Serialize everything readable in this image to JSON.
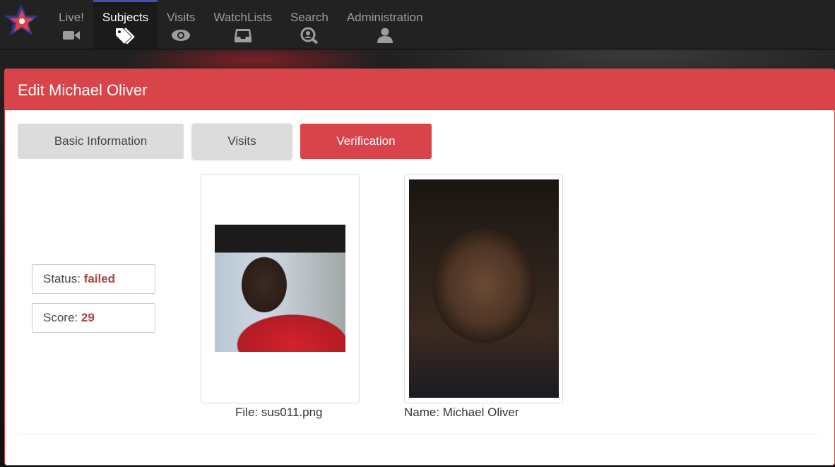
{
  "nav": {
    "items": [
      {
        "label": "Live!",
        "icon": "video-camera-icon"
      },
      {
        "label": "Subjects",
        "icon": "tags-icon",
        "active": true
      },
      {
        "label": "Visits",
        "icon": "eye-icon"
      },
      {
        "label": "WatchLists",
        "icon": "inbox-icon"
      },
      {
        "label": "Search",
        "icon": "search-face-icon"
      },
      {
        "label": "Administration",
        "icon": "user-icon"
      }
    ]
  },
  "panel": {
    "title": "Edit Michael Oliver",
    "tabs": [
      {
        "label": "Basic Information"
      },
      {
        "label": "Visits"
      },
      {
        "label": "Verification",
        "active": true
      }
    ]
  },
  "verification": {
    "status_label": "Status:",
    "status_value": "failed",
    "score_label": "Score:",
    "score_value": "29",
    "file_caption": "File: sus011.png",
    "name_caption": "Name: Michael Oliver"
  },
  "colors": {
    "accent": "#d9434a",
    "nav_active_border": "#3f51b5",
    "status_value": "#a94442"
  }
}
